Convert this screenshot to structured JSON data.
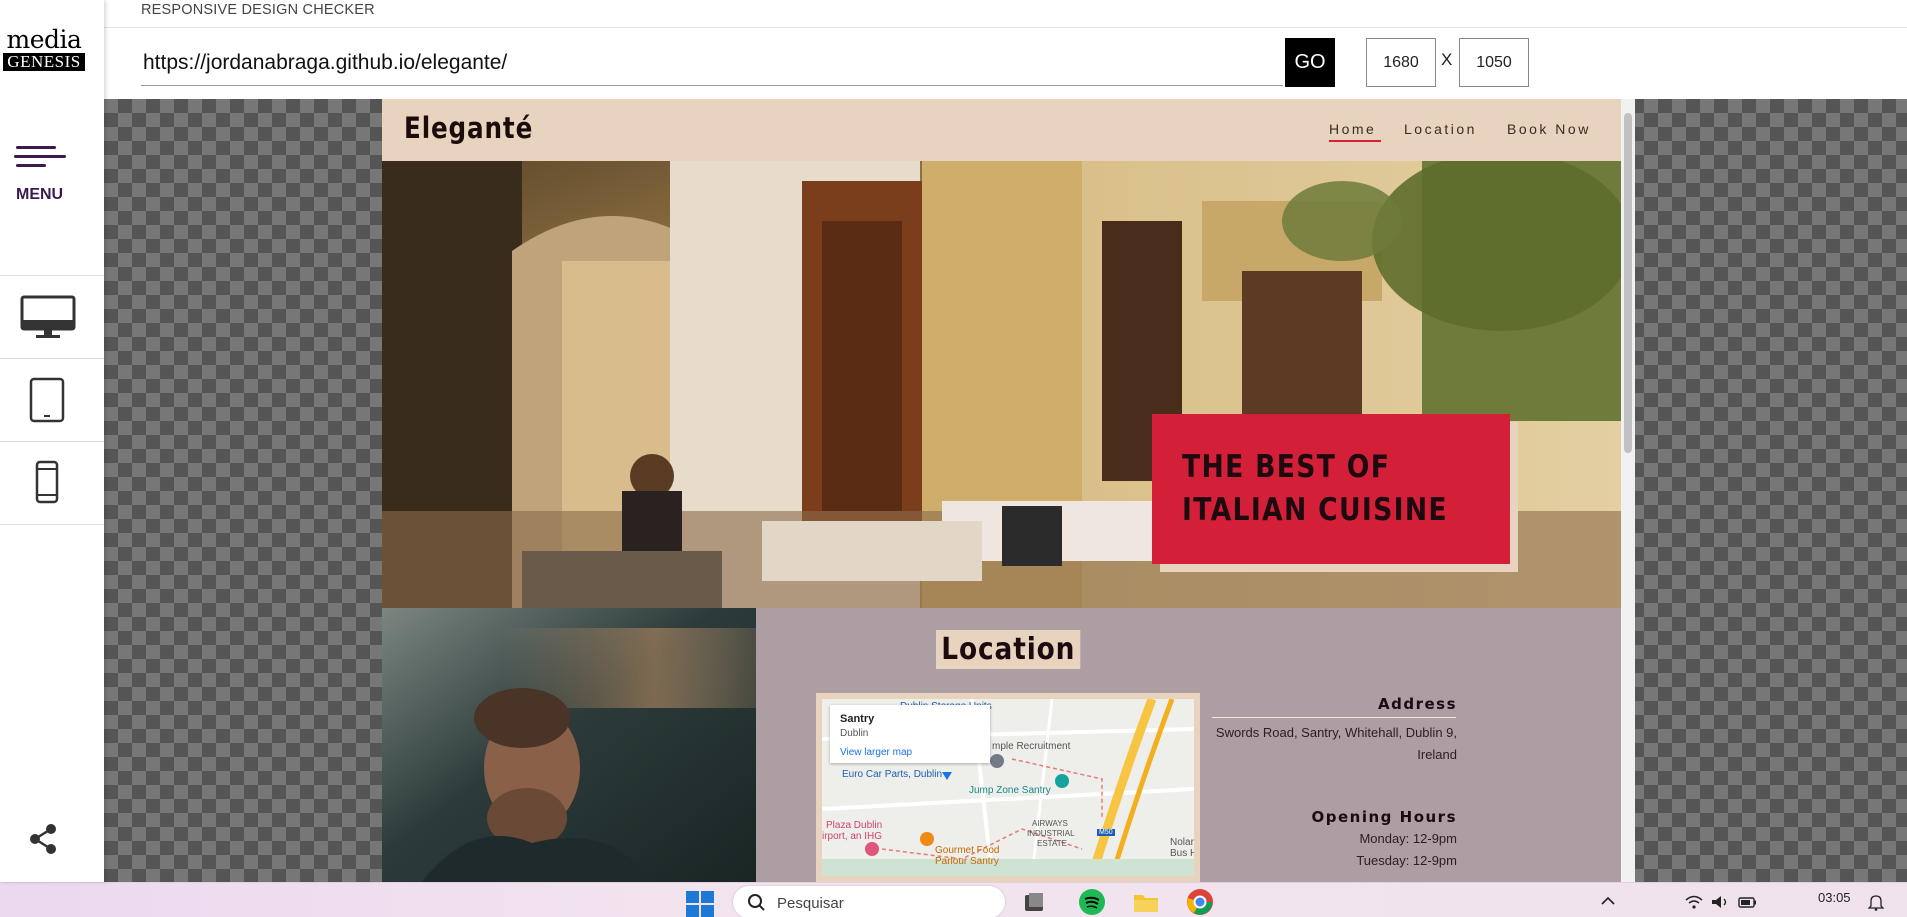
{
  "app": {
    "title": "RESPONSIVE DESIGN CHECKER",
    "logo_top": "media",
    "logo_bottom": "GENESIS"
  },
  "sidebar": {
    "menu_label": "MENU",
    "devices": [
      {
        "name": "desktop",
        "icon": "desktop-monitor-icon"
      },
      {
        "name": "tablet",
        "icon": "tablet-icon"
      },
      {
        "name": "mobile",
        "icon": "mobile-phone-icon"
      }
    ],
    "share_icon": "share-icon"
  },
  "toolbar": {
    "url": "https://jordanabraga.github.io/elegante/",
    "go_label": "GO",
    "width": "1680",
    "separator": "X",
    "height": "1050"
  },
  "site": {
    "brand": "Eleganté",
    "nav": [
      "Home",
      "Location",
      "Book Now"
    ],
    "active_nav": "Home",
    "hero_line1": "THE BEST OF",
    "hero_line2": "ITALIAN CUISINE",
    "location_title": "Location",
    "map": {
      "card_title": "Santry",
      "card_subtitle": "Dublin",
      "card_link": "View larger map",
      "labels": [
        "Dublin Storage Units",
        "mple Recruitment",
        "Euro Car Parts, Dublin",
        "Jump Zone Santry",
        "Plaza Dublin",
        "irport, an IHG",
        "Gourmet Food",
        "Parlour Santry",
        "AIRWAYS",
        "INDUSTRIAL",
        "ESTATE",
        "Nolar",
        "Bus H",
        "M50"
      ]
    },
    "address_heading": "Address",
    "address_line1": "Swords Road, Santry, Whitehall, Dublin 9,",
    "address_line2": "Ireland",
    "hours_heading": "Opening Hours",
    "hours": [
      "Monday: 12-9pm",
      "Tuesday: 12-9pm"
    ]
  },
  "taskbar": {
    "search_placeholder": "Pesquisar",
    "time": "03:05"
  },
  "colors": {
    "accent_red": "#d41f39",
    "cream": "#e8d3bf",
    "mauve": "#ad9ea3",
    "menu_purple": "#3b1b4f"
  }
}
